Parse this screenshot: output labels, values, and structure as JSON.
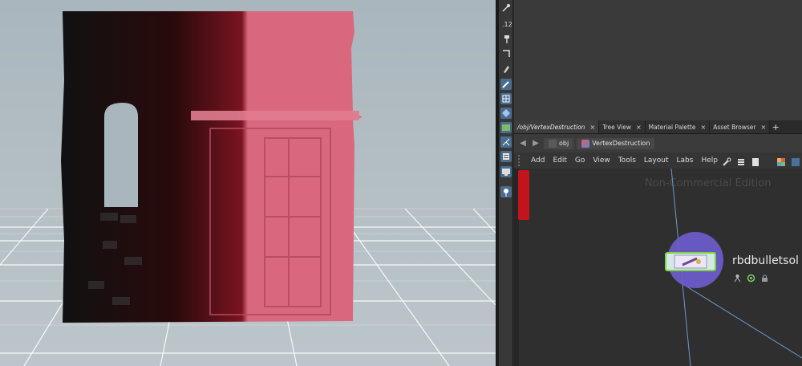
{
  "network_editor": {
    "tabs": [
      {
        "label": "/obj/VertexDestruction",
        "active": true
      },
      {
        "label": "Tree View",
        "active": false
      },
      {
        "label": "Material Palette",
        "active": false
      },
      {
        "label": "Asset Browser",
        "active": false
      }
    ],
    "tab_close_glyph": "×",
    "add_tab_glyph": "+",
    "path": {
      "root": "obj",
      "current": "VertexDestruction"
    },
    "menu": [
      "Add",
      "Edit",
      "Go",
      "View",
      "Tools",
      "Layout",
      "Labs",
      "Help"
    ],
    "watermark": "Non-Commercial Edition",
    "node": {
      "name": "rbdbulletsol",
      "icon": "rbd-solver-icon"
    }
  },
  "tool_icons": [
    "handle-icon",
    "snap-icon",
    "hammer-icon",
    "frame-icon",
    "brush-icon",
    "grid-select-icon",
    "diamond-icon",
    "image-icon",
    "skeleton-icon",
    "panel-icon",
    "display-icon",
    "pin-icon"
  ],
  "colors": {
    "selected_wire_red": "#c2141c",
    "node_border_green": "#7cd63b",
    "node_circle_purple": "#6a5cc7",
    "wall_pink": "#d9687f"
  }
}
